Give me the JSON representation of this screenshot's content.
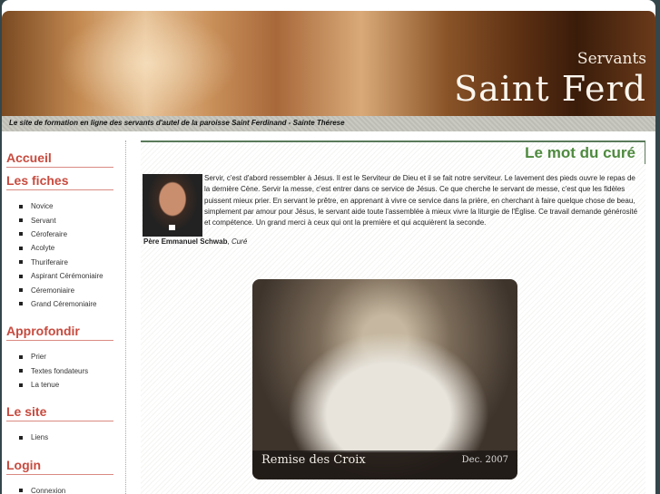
{
  "header": {
    "brand_small": "Servants",
    "brand_big": "Saint Ferd",
    "tagline": "Le site de formation en ligne des servants d'autel de la paroisse Saint Ferdinand - Sainte Thérese"
  },
  "sidebar": {
    "accueil": "Accueil",
    "fiches": {
      "title": "Les fiches",
      "items": [
        "Novice",
        "Servant",
        "Céroferaire",
        "Acolyte",
        "Thuriferaire",
        "Aspirant Cérémoniaire",
        "Céremoniaire",
        "Grand Céremoniaire"
      ]
    },
    "approfondir": {
      "title": "Approfondir",
      "items": [
        "Prier",
        "Textes fondateurs",
        "La tenue"
      ]
    },
    "site": {
      "title": "Le site",
      "items": [
        "Liens"
      ]
    },
    "login": {
      "title": "Login",
      "items": [
        "Connexion"
      ]
    }
  },
  "main": {
    "title": "Le mot du curé",
    "message": "Servir, c'est d'abord ressembler à Jésus. Il est le Serviteur de Dieu et il se fait notre serviteur. Le lavement des pieds ouvre le repas de la dernière Cène. Servir la messe, c'est entrer dans ce service de Jésus. Ce que cherche le servant de messe, c'est que les fidèles puissent mieux prier. En servant le prêtre, en apprenant à vivre ce service dans la prière, en cherchant à faire quelque chose de beau, simplement par amour pour Jésus, le servant aide toute l'assemblée à mieux vivre la liturgie de l'Église. Ce travail demande générosité et compétence. Un grand merci à ceux qui ont la première et qui acquièrent la seconde.",
    "signature_name": "Père Emmanuel Schwab",
    "signature_role": "Curé",
    "photo_caption": "Remise des Croix",
    "photo_date": "Dec. 2007"
  }
}
